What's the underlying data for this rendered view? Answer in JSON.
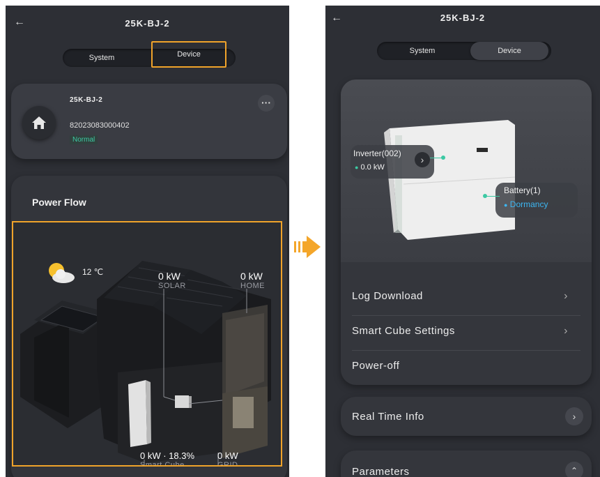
{
  "left": {
    "title": "25K-BJ-2",
    "tabs": {
      "system": "System",
      "device": "Device"
    },
    "station": {
      "name": "25K-BJ-2",
      "serial": "82023083000402",
      "status": "Normal"
    },
    "power_flow": {
      "heading": "Power Flow",
      "temperature": "12 ℃",
      "solar_value": "0 kW",
      "solar_label": "SOLAR",
      "home_value": "0 kW",
      "home_label": "HOME",
      "cube_value": "0 kW · 18.3%",
      "cube_label": "Smart Cube",
      "grid_value": "0 kW",
      "grid_label": "GRID"
    }
  },
  "right": {
    "title": "25K-BJ-2",
    "tabs": {
      "system": "System",
      "device": "Device"
    },
    "device": {
      "inverter_label": "Inverter(002)",
      "inverter_value": "0.0 kW",
      "battery_label": "Battery(1)",
      "battery_status": "Dormancy"
    },
    "menu": {
      "log_download": "Log Download",
      "smart_cube_settings": "Smart Cube Settings",
      "power_off": "Power-off",
      "real_time_info": "Real Time Info",
      "parameters": "Parameters"
    }
  },
  "colors": {
    "accent_green": "#3cc9a3",
    "highlight_orange": "#f0a32a",
    "arrow_orange": "#f4a62a",
    "battery_blue": "#3db6f2"
  }
}
